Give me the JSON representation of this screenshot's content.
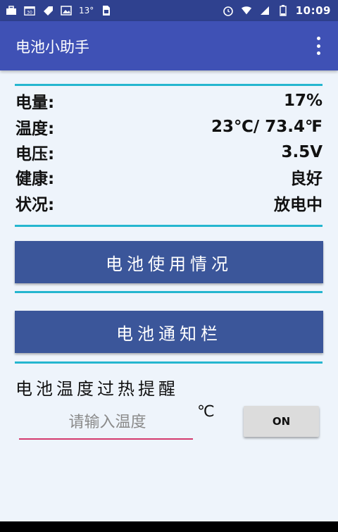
{
  "status_bar": {
    "temperature": "13°",
    "time": "10:09",
    "icons": [
      "briefcase-icon",
      "calendar-icon",
      "tag-icon",
      "image-icon",
      "sim-icon",
      "alarm-icon",
      "wifi-icon",
      "signal-icon",
      "battery-icon"
    ]
  },
  "app_bar": {
    "title": "电池小助手",
    "menu_icon": "more-vert-icon"
  },
  "battery_info": [
    {
      "label": "电量:",
      "value": "17%"
    },
    {
      "label": "温度:",
      "value": "23℃/ 73.4℉"
    },
    {
      "label": "电压:",
      "value": "3.5V"
    },
    {
      "label": "健康:",
      "value": "良好"
    },
    {
      "label": "状况:",
      "value": "放电中"
    }
  ],
  "buttons": {
    "usage": "电池使用情况",
    "notification": "电池通知栏"
  },
  "overheat": {
    "label": "电池温度过热提醒",
    "input_placeholder": "请输入温度",
    "input_value": "",
    "unit": "℃",
    "toggle_label": "ON"
  },
  "colors": {
    "status_bar": "#2f418f",
    "app_bar": "#3f51b5",
    "button": "#3b569a",
    "divider": "#25b6cf",
    "input_underline": "#d43a6e",
    "background": "#eef4fb"
  }
}
